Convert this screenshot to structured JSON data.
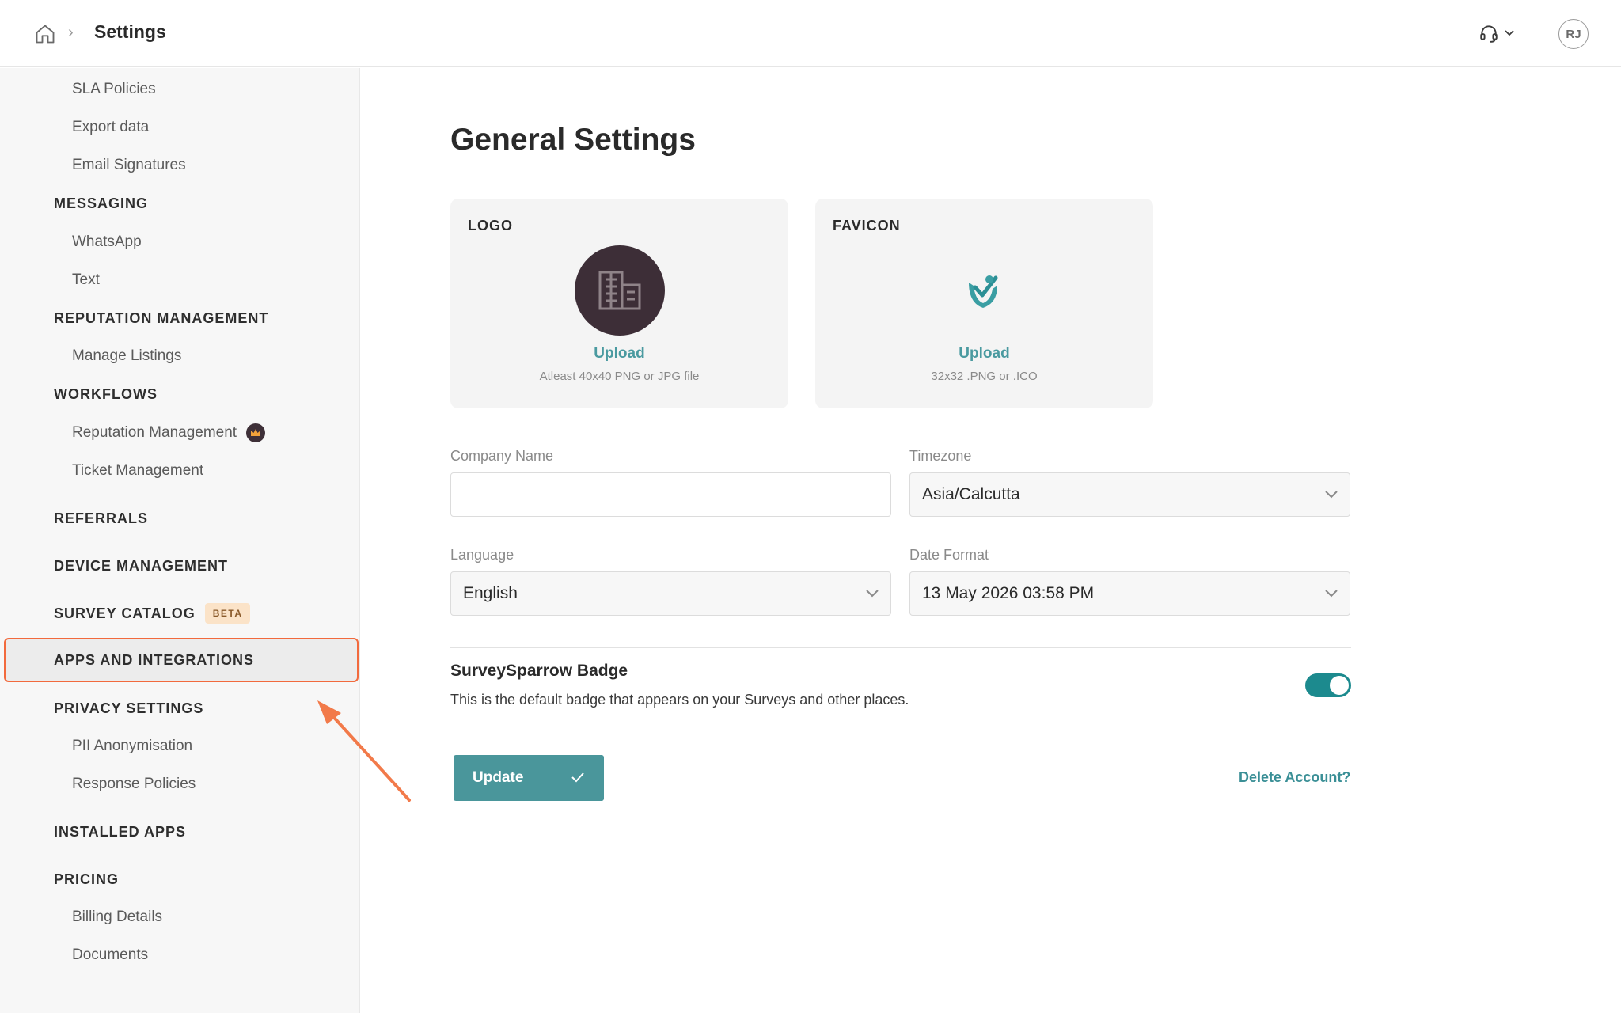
{
  "header": {
    "page_title": "Settings",
    "breadcrumb_separator": "›",
    "avatar_initials": "RJ",
    "icons": [
      "home-icon",
      "chevron-right-icon",
      "headset-icon",
      "chevron-down-icon"
    ]
  },
  "sidebar": {
    "sla_policies": "SLA Policies",
    "export_data": "Export data",
    "email_signatures": "Email Signatures",
    "messaging": "MESSAGING",
    "whatsapp": "WhatsApp",
    "text": "Text",
    "reputation_management_head": "REPUTATION MANAGEMENT",
    "manage_listings": "Manage Listings",
    "workflows": "WORKFLOWS",
    "reputation_management": "Reputation Management",
    "ticket_management": "Ticket Management",
    "referrals": "REFERRALS",
    "device_management": "DEVICE MANAGEMENT",
    "survey_catalog": "SURVEY CATALOG",
    "beta_badge": "BETA",
    "apps_and_integrations": "APPS AND INTEGRATIONS",
    "privacy_settings": "PRIVACY SETTINGS",
    "pii_anonymisation": "PII Anonymisation",
    "response_policies": "Response Policies",
    "installed_apps": "INSTALLED APPS",
    "pricing": "PRICING",
    "billing_details": "Billing Details",
    "documents": "Documents"
  },
  "main": {
    "title": "General Settings",
    "logo_card": {
      "label": "LOGO",
      "upload": "Upload",
      "hint": "Atleast 40x40 PNG or JPG file"
    },
    "favicon_card": {
      "label": "FAVICON",
      "upload": "Upload",
      "hint": "32x32 .PNG or .ICO"
    },
    "company_name": {
      "label": "Company Name",
      "value": ""
    },
    "timezone": {
      "label": "Timezone",
      "value": "Asia/Calcutta"
    },
    "language": {
      "label": "Language",
      "value": "English"
    },
    "date_format": {
      "label": "Date Format",
      "value": "13 May 2026 03:58 PM"
    },
    "badge": {
      "title": "SurveySparrow Badge",
      "description": "This is the default badge that appears on your Surveys and other places.",
      "enabled": true
    },
    "update_button": "Update",
    "delete_account": "Delete Account?"
  },
  "colors": {
    "accent": "#4a969b",
    "toggle_on": "#1c8a8e",
    "highlight_border": "#f26a3d",
    "logo_bg": "#3d2e37"
  }
}
